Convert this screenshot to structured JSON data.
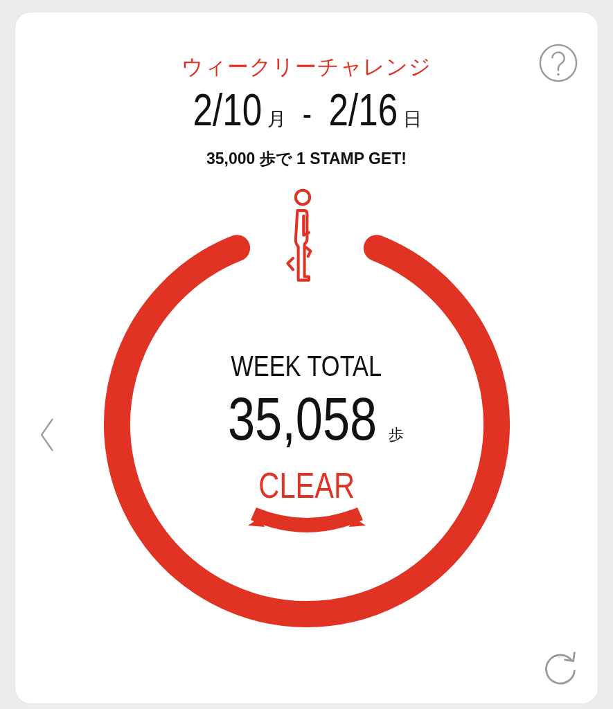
{
  "header": {
    "title": "ウィークリーチャレンジ",
    "start_date": "2/10",
    "start_day": "月",
    "separator": "-",
    "end_date": "2/16",
    "end_day": "日",
    "goal_text": "35,000 歩で 1 STAMP GET!"
  },
  "progress": {
    "label": "WEEK TOTAL",
    "steps": "35,058",
    "unit": "歩",
    "cleared": true,
    "badge": "CLEAR"
  }
}
